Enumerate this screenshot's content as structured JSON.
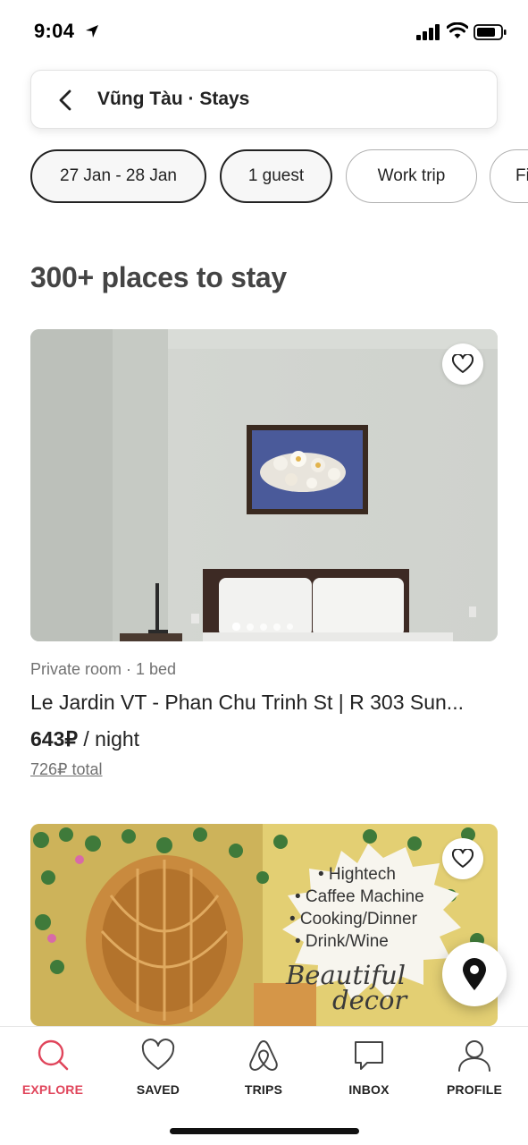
{
  "status_bar": {
    "time": "9:04"
  },
  "search": {
    "title": "Vũng Tàu · Stays"
  },
  "filters": [
    {
      "label": "27 Jan - 28 Jan",
      "active": true
    },
    {
      "label": "1 guest",
      "active": true
    },
    {
      "label": "Work trip",
      "active": false
    },
    {
      "label": "Fi",
      "active": false
    }
  ],
  "results": {
    "heading": "300+ places to stay"
  },
  "listings": [
    {
      "subtitle": "Private room · 1 bed",
      "title": "Le Jardin VT - Phan Chu Trinh St | R 303 Sun...",
      "price": "643₽",
      "price_unit": " / night",
      "total": "726₽ total",
      "photo_count": 5,
      "photo_index": 1
    },
    {
      "photo_text": {
        "items": [
          "• Hightech",
          "• Caffee Machine",
          "• Cooking/Dinner",
          "• Drink/Wine"
        ],
        "script_line1": "Beautiful",
        "script_line2": "decor"
      }
    }
  ],
  "tabs": [
    {
      "label": "EXPLORE",
      "icon": "search-icon",
      "active": true
    },
    {
      "label": "SAVED",
      "icon": "heart-icon",
      "active": false
    },
    {
      "label": "TRIPS",
      "icon": "airbnb-logo-icon",
      "active": false
    },
    {
      "label": "INBOX",
      "icon": "chat-bubble-icon",
      "active": false
    },
    {
      "label": "PROFILE",
      "icon": "person-icon",
      "active": false
    }
  ],
  "colors": {
    "accent": "#e0455b",
    "text": "#222222",
    "muted": "#717171"
  }
}
